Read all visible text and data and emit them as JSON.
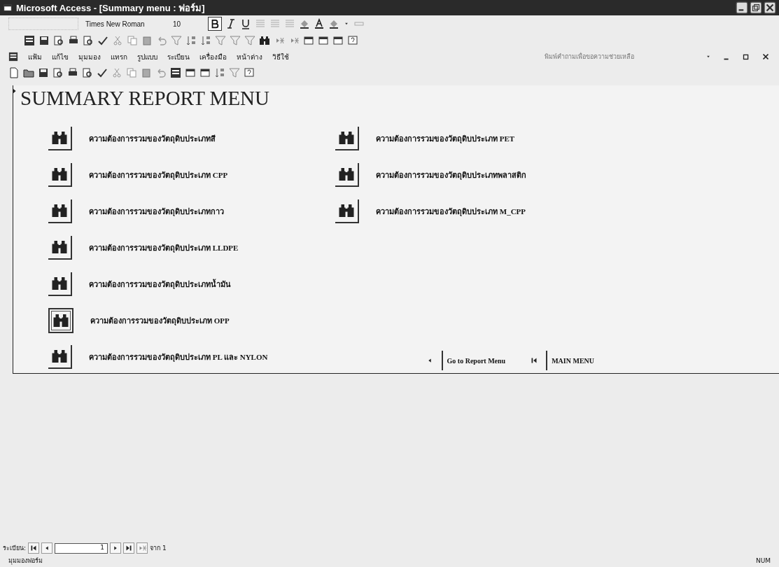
{
  "window": {
    "title": "Microsoft Access - [Summary menu : ฟอร์ม]"
  },
  "formatting_toolbar": {
    "font": "Times New Roman",
    "size": "10",
    "bold": true
  },
  "menu": {
    "items": [
      "แฟ้ม",
      "แก้ไข",
      "มุมมอง",
      "แทรก",
      "รูปแบบ",
      "ระเบียน",
      "เครื่องมือ",
      "หน้าต่าง",
      "วิธีใช้"
    ],
    "help_box": {
      "placeholder": "พิมพ์คำถามเพื่อขอความช่วยเหลือ"
    }
  },
  "form": {
    "title": "SUMMARY REPORT MENU",
    "left_items": [
      {
        "label": "ความต้องการรวมของวัตถุดิบประเภทสี",
        "focused": false
      },
      {
        "label": "ความต้องการรวมของวัตถุดิบประเภท CPP",
        "focused": false
      },
      {
        "label": "ความต้องการรวมของวัตถุดิบประเภทกาว",
        "focused": false
      },
      {
        "label": "ความต้องการรวมของวัตถุดิบประเภท LLDPE",
        "focused": false
      },
      {
        "label": "ความต้องการรวมของวัตถุดิบประเภทน้ำมัน",
        "focused": false
      },
      {
        "label": "ความต้องการรวมของวัตถุดิบประเภท OPP",
        "focused": true
      },
      {
        "label": "ความต้องการรวมของวัตถุดิบประเภท PL และ NYLON",
        "focused": false
      }
    ],
    "right_items": [
      {
        "label": "ความต้องการรวมของวัตถุดิบประเภท PET",
        "focused": false
      },
      {
        "label": "ความต้องการรวมของวัตถุดิบประเภทพลาสติก",
        "focused": false
      },
      {
        "label": "ความต้องการรวมของวัตถุดิบประเภท M_CPP",
        "focused": false
      }
    ],
    "nav_links": [
      "Go to Report Menu",
      "MAIN MENU"
    ]
  },
  "record_nav": {
    "label": "ระเบียน:",
    "current": "1",
    "total": "จาก 1"
  },
  "status_bar": {
    "mode": "มุมมองฟอร์ม",
    "indicator": "NUM"
  }
}
